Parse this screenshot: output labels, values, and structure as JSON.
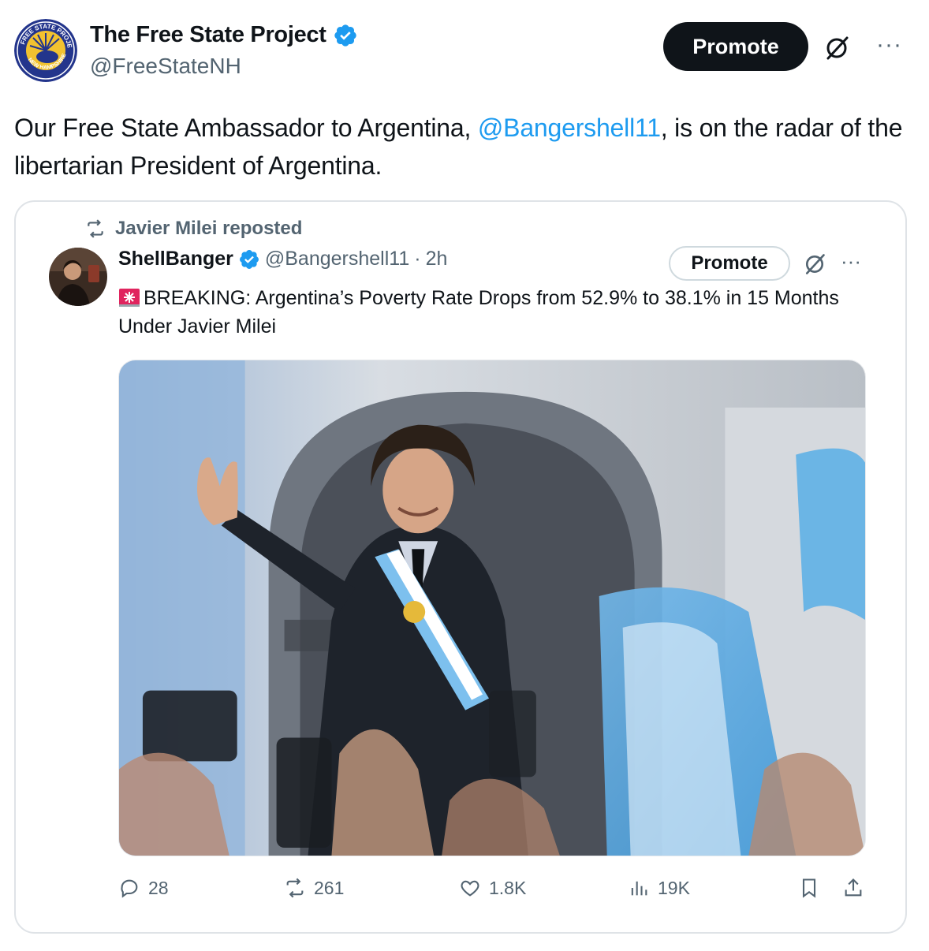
{
  "post": {
    "author_name": "The Free State Project",
    "author_handle": "@FreeStateNH",
    "promote_label": "Promote",
    "more_label": "···",
    "text_before": "Our Free State Ambassador to Argentina, ",
    "mention": "@Bangershell11",
    "text_after": ", is on the radar of the libertarian President of Argentina.",
    "avatar_lettering": "FREE STATE PROJECT · NEW HAMPSHIRE"
  },
  "quoted": {
    "repost_label": "Javier Milei reposted",
    "author_name": "ShellBanger",
    "author_handle": "@Bangershell11",
    "separator": "·",
    "time": "2h",
    "promote_label": "Promote",
    "more_label": "···",
    "text": "BREAKING: Argentina’s Poverty Rate Drops from 52.9% to 38.1% in 15 Months Under Javier Milei",
    "stats": {
      "replies": "28",
      "reposts": "261",
      "likes": "1.8K",
      "views": "19K"
    }
  },
  "colors": {
    "accent": "#1d9bf0",
    "text_secondary": "#536471",
    "button_dark": "#0f1419",
    "border": "#dfe3e7"
  },
  "icons": [
    "verified-badge-icon",
    "grok-icon",
    "more-icon",
    "repost-icon",
    "siren-icon",
    "reply-icon",
    "like-icon",
    "views-icon",
    "bookmark-icon",
    "share-icon"
  ]
}
